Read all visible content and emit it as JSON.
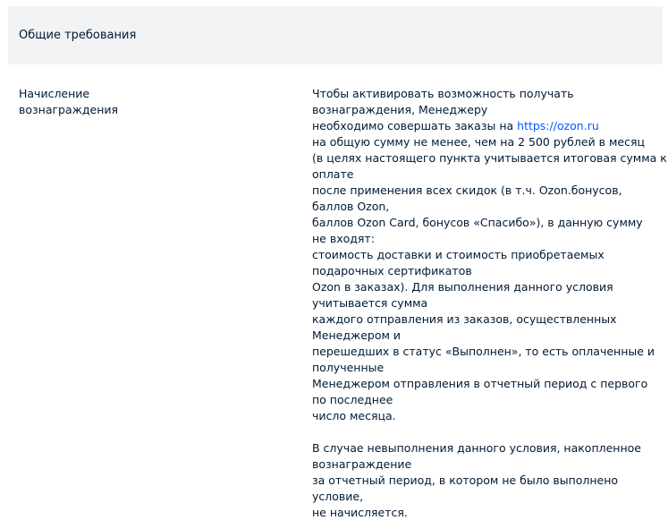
{
  "section": {
    "title": "Общие требования"
  },
  "row": {
    "label_lines": [
      "Начисление",
      "вознаграждения"
    ],
    "paragraph1": {
      "line1": "Чтобы активировать возможность получать",
      "line2": "вознаграждения, Менеджеру",
      "line3_prefix": "необходимо совершать заказы на ",
      "link_text": "https://ozon.ru",
      "lines_rest": [
        "на общую сумму не менее, чем на 2 500 рублей в месяц",
        "(в целях настоящего пункта учитывается итоговая сумма к",
        "оплате",
        "после применения всех скидок (в т.ч. Ozon.бонусов,",
        "баллов Ozon,",
        "баллов Ozon Card, бонусов «Спасибо»), в данную сумму",
        "не входят:",
        "стоимость доставки и стоимость приобретаемых",
        "подарочных сертификатов",
        "Ozon в заказах). Для выполнения данного условия",
        "учитывается сумма",
        "каждого отправления из заказов, осуществленных",
        "Менеджером и",
        "перешедших в статус «Выполнен», то есть оплаченные и",
        "полученные",
        "Менеджером отправления в отчетный период с первого",
        "по последнее",
        "число месяца."
      ]
    },
    "paragraph2": {
      "lines": [
        "В случае невыполнения данного условия, накопленное",
        "вознаграждение",
        "за отчетный период, в котором не было выполнено",
        "условие,",
        "не начисляется."
      ]
    }
  },
  "colors": {
    "text": "#001a34",
    "link": "#005bff",
    "header_bg": "#f2f3f5"
  }
}
